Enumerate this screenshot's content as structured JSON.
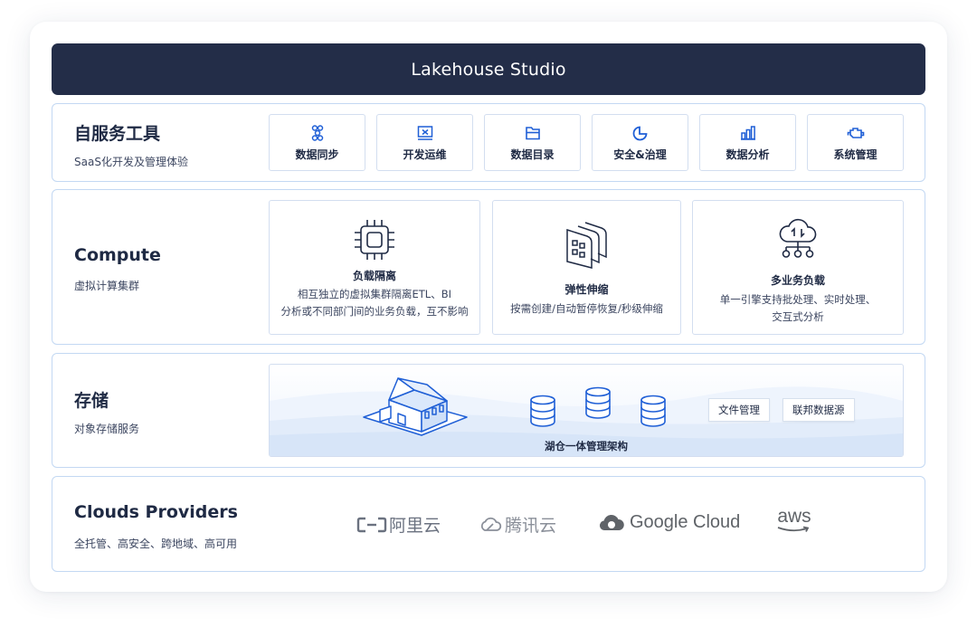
{
  "header": {
    "title": "Lakehouse Studio"
  },
  "self_service": {
    "title": "自服务工具",
    "subtitle": "SaaS化开发及管理体验",
    "tools": [
      {
        "label": "数据同步",
        "icon": "data-sync-icon"
      },
      {
        "label": "开发运维",
        "icon": "dev-ops-icon"
      },
      {
        "label": "数据目录",
        "icon": "data-catalog-icon"
      },
      {
        "label": "安全&治理",
        "icon": "security-governance-icon"
      },
      {
        "label": "数据分析",
        "icon": "data-analysis-icon"
      },
      {
        "label": "系统管理",
        "icon": "system-management-icon"
      }
    ]
  },
  "compute": {
    "title": "Compute",
    "subtitle": "虚拟计算集群",
    "features": [
      {
        "title": "负载隔离",
        "desc1": "相互独立的虚拟集群隔离ETL、BI",
        "desc2": "分析或不同部门间的业务负载，互不影响"
      },
      {
        "title": "弹性伸缩",
        "desc1": "按需创建/自动暂停恢复/秒级伸缩",
        "desc2": ""
      },
      {
        "title": "多业务负载",
        "desc1": "单一引擎支持批处理、实时处理、",
        "desc2": "交互式分析"
      }
    ]
  },
  "storage": {
    "title": "存储",
    "subtitle": "对象存储服务",
    "lake_label": "湖仓一体管理架构",
    "tags": [
      "文件管理",
      "联邦数据源"
    ]
  },
  "clouds": {
    "title": "Clouds Providers",
    "subtitle": "全托管、高安全、跨地域、高可用",
    "providers": [
      {
        "name": "阿里云",
        "icon": "aliyun-logo-icon"
      },
      {
        "name": "腾讯云",
        "icon": "tencent-cloud-logo-icon"
      },
      {
        "name": "Google Cloud",
        "icon": "google-cloud-logo-icon"
      },
      {
        "name": "aws",
        "icon": "aws-logo-icon"
      }
    ]
  },
  "colors": {
    "header_bg": "#232d48",
    "accent": "#1f5fd6",
    "border": "#c3d8f3"
  }
}
